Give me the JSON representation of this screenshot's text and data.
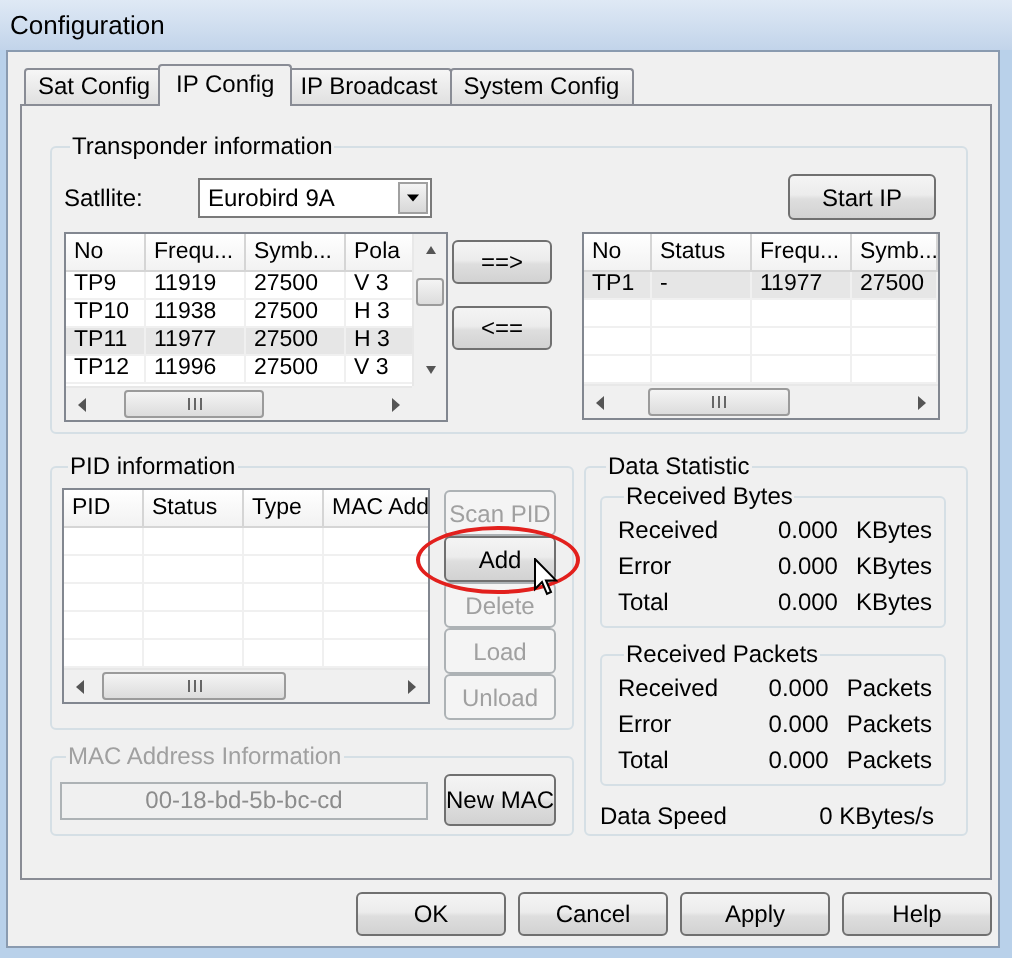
{
  "window": {
    "title": "Configuration"
  },
  "tabs": [
    {
      "label": "Sat Config",
      "selected": false
    },
    {
      "label": "IP Config",
      "selected": true
    },
    {
      "label": "IP Broadcast",
      "selected": false
    },
    {
      "label": "System Config",
      "selected": false
    }
  ],
  "transponder_information": {
    "title": "Transponder information",
    "satellite_label": "Satllite:",
    "satellite": "Eurobird 9A",
    "start_button": "Start IP",
    "available_list": {
      "columns": [
        "No",
        "Frequ...",
        "Symb...",
        "Pola"
      ],
      "rows": [
        {
          "cells": [
            "TP9",
            "11919",
            "27500",
            "V 3"
          ],
          "selected": false
        },
        {
          "cells": [
            "TP10",
            "11938",
            "27500",
            "H 3"
          ],
          "selected": false
        },
        {
          "cells": [
            "TP11",
            "11977",
            "27500",
            "H 3"
          ],
          "selected": true
        },
        {
          "cells": [
            "TP12",
            "11996",
            "27500",
            "V 3"
          ],
          "selected": false
        }
      ]
    },
    "move_buttons": [
      "==>",
      "<=="
    ],
    "selected_list": {
      "columns": [
        "No",
        "Status",
        "Frequ...",
        "Symb..."
      ],
      "rows": [
        {
          "cells": [
            "TP1",
            "-",
            "11977",
            "27500"
          ],
          "selected": true
        }
      ]
    }
  },
  "pid_information": {
    "title": "PID information",
    "columns": [
      "PID",
      "Status",
      "Type",
      "MAC Add"
    ],
    "buttons": [
      {
        "label": "Scan PID",
        "disabled": true
      },
      {
        "label": "Add",
        "disabled": false
      },
      {
        "label": "Delete",
        "disabled": true
      },
      {
        "label": "Load",
        "disabled": true
      },
      {
        "label": "Unload",
        "disabled": true
      }
    ]
  },
  "mac_address_information": {
    "title": "MAC Address Information",
    "disabled": true,
    "address": "00-18-bd-5b-bc-cd",
    "button": "New MAC"
  },
  "data_statistic": {
    "title": "Data Statistic",
    "sections": [
      {
        "title": "Received Bytes",
        "rows": [
          {
            "label": "Received",
            "value": "0.000",
            "unit": "KBytes"
          },
          {
            "label": "Error",
            "value": "0.000",
            "unit": "KBytes"
          },
          {
            "label": "Total",
            "value": "0.000",
            "unit": "KBytes"
          }
        ]
      },
      {
        "title": "Received Packets",
        "rows": [
          {
            "label": "Received",
            "value": "0.000",
            "unit": "Packets"
          },
          {
            "label": "Error",
            "value": "0.000",
            "unit": "Packets"
          },
          {
            "label": "Total",
            "value": "0.000",
            "unit": "Packets"
          }
        ]
      }
    ],
    "speed_label": "Data Speed",
    "speed_value": "0 KBytes/s"
  },
  "dialog_buttons": [
    "OK",
    "Cancel",
    "Apply",
    "Help"
  ]
}
